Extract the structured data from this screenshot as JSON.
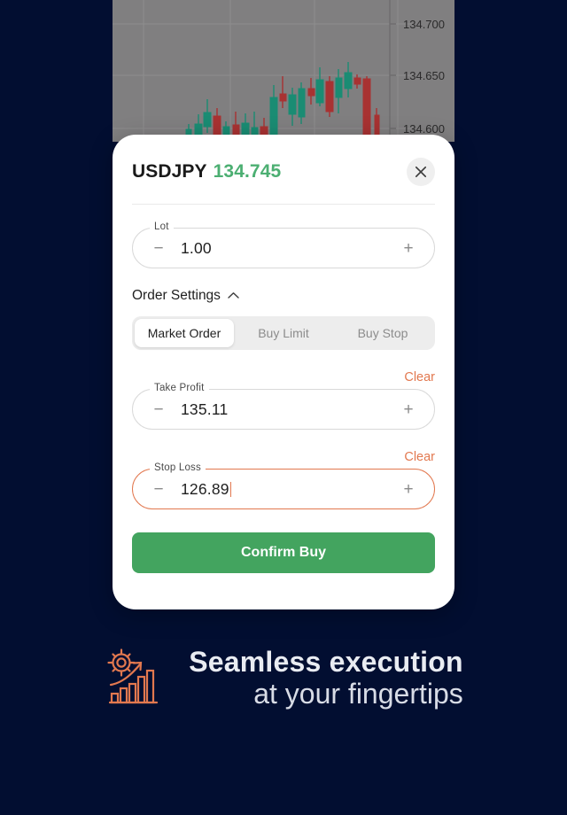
{
  "background_color": "#020E31",
  "chart": {
    "axis_labels": [
      "134.700",
      "134.650",
      "134.600"
    ],
    "bull_color": "#1A8C73",
    "bear_color": "#A83232",
    "panel_color": "#807F80"
  },
  "modal": {
    "symbol": "USDJPY",
    "price": "134.745",
    "price_color": "#4CAF72",
    "close_icon": "close-icon",
    "lot": {
      "label": "Lot",
      "value": "1.00",
      "decrement": "−",
      "increment": "+"
    },
    "order_settings": {
      "label": "Order Settings",
      "chevron": "chevron-up-icon",
      "tabs": [
        {
          "label": "Market Order",
          "active": true
        },
        {
          "label": "Buy Limit",
          "active": false
        },
        {
          "label": "Buy Stop",
          "active": false
        }
      ]
    },
    "take_profit": {
      "clear_label": "Clear",
      "label": "Take Profit",
      "value": "135.11",
      "decrement": "−",
      "increment": "+",
      "focused": false
    },
    "stop_loss": {
      "clear_label": "Clear",
      "label": "Stop Loss",
      "value": "126.89",
      "decrement": "−",
      "increment": "+",
      "focused": true
    },
    "confirm_label": "Confirm Buy",
    "confirm_color": "#43A45F"
  },
  "tagline": {
    "icon": "growth-target-icon",
    "icon_color": "#E2784F",
    "line1": "Seamless execution",
    "line2": "at your fingertips"
  }
}
